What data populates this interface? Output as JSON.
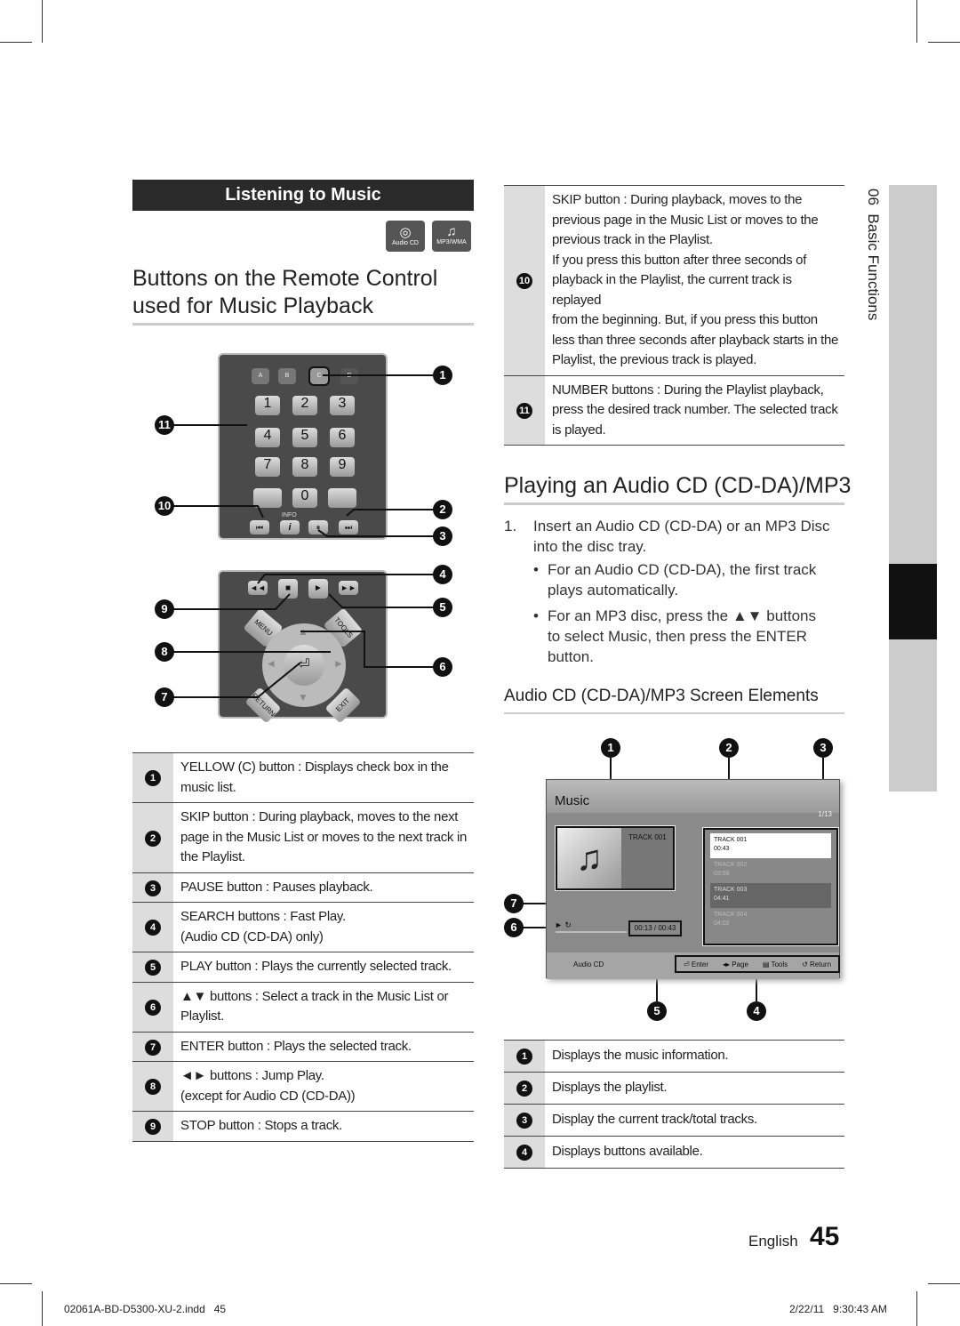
{
  "section_header": "Listening to Music",
  "disc_icons": [
    "Audio CD",
    "MP3/WMA"
  ],
  "left_title": [
    "Buttons on the Remote Control",
    "used for Music Playback"
  ],
  "remote": {
    "color_keys": [
      "A",
      "B",
      "C",
      "D"
    ],
    "number_keys": [
      "1",
      "2",
      "3",
      "4",
      "5",
      "6",
      "7",
      "8",
      "9",
      "0"
    ],
    "info_label": "INFO",
    "menu": "MENU",
    "tools": "TOOLS",
    "return": "RETURN",
    "exit": "EXIT"
  },
  "left_table": [
    {
      "n": "1",
      "lines": [
        "YELLOW (C) button : Displays check box in the",
        "music list."
      ]
    },
    {
      "n": "2",
      "lines": [
        "SKIP button : During playback, moves to the next",
        "page in the Music List or moves to the next track in",
        "the Playlist."
      ]
    },
    {
      "n": "3",
      "lines": [
        "PAUSE button : Pauses playback."
      ]
    },
    {
      "n": "4",
      "lines": [
        "SEARCH buttons : Fast Play.",
        "(Audio CD (CD-DA) only)"
      ]
    },
    {
      "n": "5",
      "lines": [
        "PLAY button : Plays the currently selected track."
      ]
    },
    {
      "n": "6",
      "lines": [
        "▲▼ buttons : Select a track in the Music List or",
        "Playlist."
      ]
    },
    {
      "n": "7",
      "lines": [
        "ENTER button : Plays the selected track."
      ]
    },
    {
      "n": "8",
      "lines": [
        "◄► buttons : Jump Play.",
        "(except for Audio CD (CD-DA))"
      ]
    },
    {
      "n": "9",
      "lines": [
        "STOP button : Stops a track."
      ]
    }
  ],
  "right_table": [
    {
      "n": "10",
      "lines": [
        "SKIP button : During playback, moves to the",
        "previous page in the Music List or moves to the",
        "previous track in the Playlist.",
        "If you press this button after three seconds of",
        "playback in the Playlist, the current track is replayed",
        "from the beginning. But, if you press this button",
        "less than three seconds after playback starts in the",
        "Playlist, the previous track is played."
      ]
    },
    {
      "n": "11",
      "lines": [
        "NUMBER buttons : During the Playlist playback,",
        "press the desired track number. The selected track",
        "is played."
      ]
    }
  ],
  "right_title": "Playing an Audio CD (CD-DA)/MP3",
  "step1": [
    "1.",
    "Insert an Audio CD (CD-DA) or an MP3 Disc",
    "into the disc tray."
  ],
  "bullets": [
    [
      "For an Audio CD (CD-DA), the first track",
      "plays automatically."
    ],
    [
      "For an MP3 disc, press the ▲▼ buttons",
      "to select Music, then press the ENTER",
      "button."
    ]
  ],
  "subtitle": "Audio CD (CD-DA)/MP3 Screen Elements",
  "screen": {
    "title": "Music",
    "count": "1/13",
    "track_label": "TRACK 001",
    "time": "00:13 / 00:43",
    "footer_left": "Audio CD",
    "buttons": [
      "Enter",
      "Page",
      "Tools",
      "Return"
    ],
    "playlist": [
      {
        "name": "TRACK 001",
        "time": "00:43"
      },
      {
        "name": "TRACK 002",
        "time": "03:56"
      },
      {
        "name": "TRACK 003",
        "time": "04:41"
      },
      {
        "name": "TRACK 004",
        "time": "04:02"
      }
    ]
  },
  "bottom_table": [
    {
      "n": "1",
      "text": "Displays the music information."
    },
    {
      "n": "2",
      "text": "Displays the playlist."
    },
    {
      "n": "3",
      "text": "Display the current track/total tracks."
    },
    {
      "n": "4",
      "text": "Displays buttons available."
    }
  ],
  "side_tab": "06  Basic Functions",
  "footer": {
    "lang": "English",
    "page": "45",
    "file": "02061A-BD-D5300-XU-2.indd   45",
    "date": "2/22/11   9:30:43 AM"
  }
}
